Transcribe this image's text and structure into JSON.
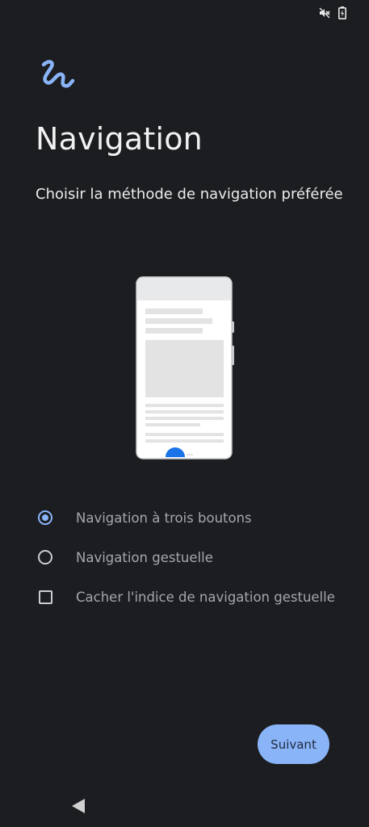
{
  "status_bar": {
    "icons": [
      "mute-icon",
      "battery-charging-icon"
    ]
  },
  "header": {
    "logo": "swirl-logo-icon",
    "title": "Navigation",
    "subtitle": "Choisir la méthode de navigation préférée"
  },
  "options": [
    {
      "label": "Navigation à trois boutons",
      "type": "radio",
      "checked": true
    },
    {
      "label": "Navigation gestuelle",
      "type": "radio",
      "checked": false
    },
    {
      "label": "Cacher l'indice de navigation gestuelle",
      "type": "checkbox",
      "checked": false
    }
  ],
  "footer": {
    "next_label": "Suivant"
  },
  "nav_bar": {
    "back_icon": "back-triangle-icon"
  },
  "colors": {
    "background": "#1b1d21",
    "accent": "#8ab4f8",
    "option_text": "#a3a7ad"
  }
}
